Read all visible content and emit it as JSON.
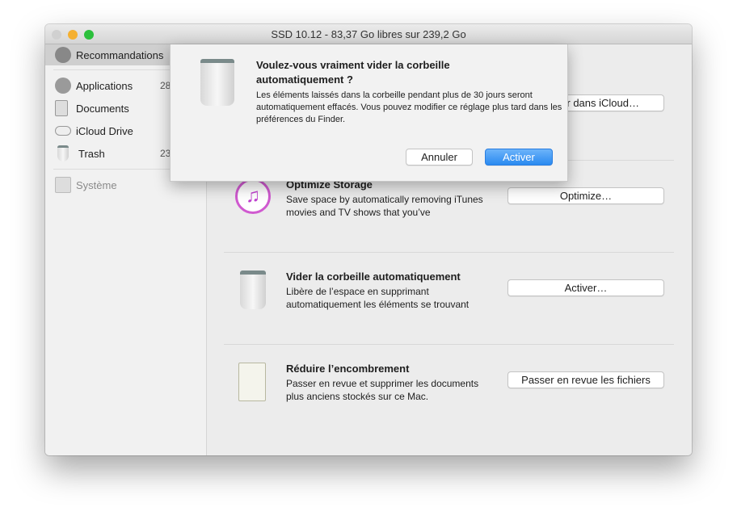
{
  "window": {
    "title": "SSD 10.12 - 83,37 Go libres sur 239,2 Go"
  },
  "sidebar": {
    "selected": "Recommandations",
    "items": [
      {
        "label": "Applications",
        "count": "28"
      },
      {
        "label": "Documents",
        "count": ""
      },
      {
        "label": "iCloud Drive",
        "count": ""
      },
      {
        "label": "Trash",
        "count": "23"
      }
    ],
    "system": "Système"
  },
  "main": {
    "rows": [
      {
        "title": "Optimize Storage",
        "desc": "Save space by automatically removing iTunes movies and TV shows that you’ve",
        "button": "Optimize…"
      },
      {
        "title": "Vider la corbeille automatiquement",
        "desc": "Libère de l’espace en supprimant automatiquement les éléments se trouvant",
        "button": "Activer…"
      },
      {
        "title": "Réduire l’encombrement",
        "desc": "Passer en revue et supprimer les documents plus anciens stockés sur ce Mac.",
        "button": "Passer en revue les fichiers"
      }
    ],
    "icloud_button": "r dans iCloud…"
  },
  "dialog": {
    "title": "Voulez-vous vraiment vider la corbeille automatiquement ?",
    "message": "Les éléments laissés dans la corbeille pendant plus de 30 jours seront automatiquement effacés. Vous pouvez modifier ce réglage plus tard dans les préférences du Finder.",
    "cancel": "Annuler",
    "confirm": "Activer"
  },
  "colors": {
    "accent": "#3b95f0"
  }
}
